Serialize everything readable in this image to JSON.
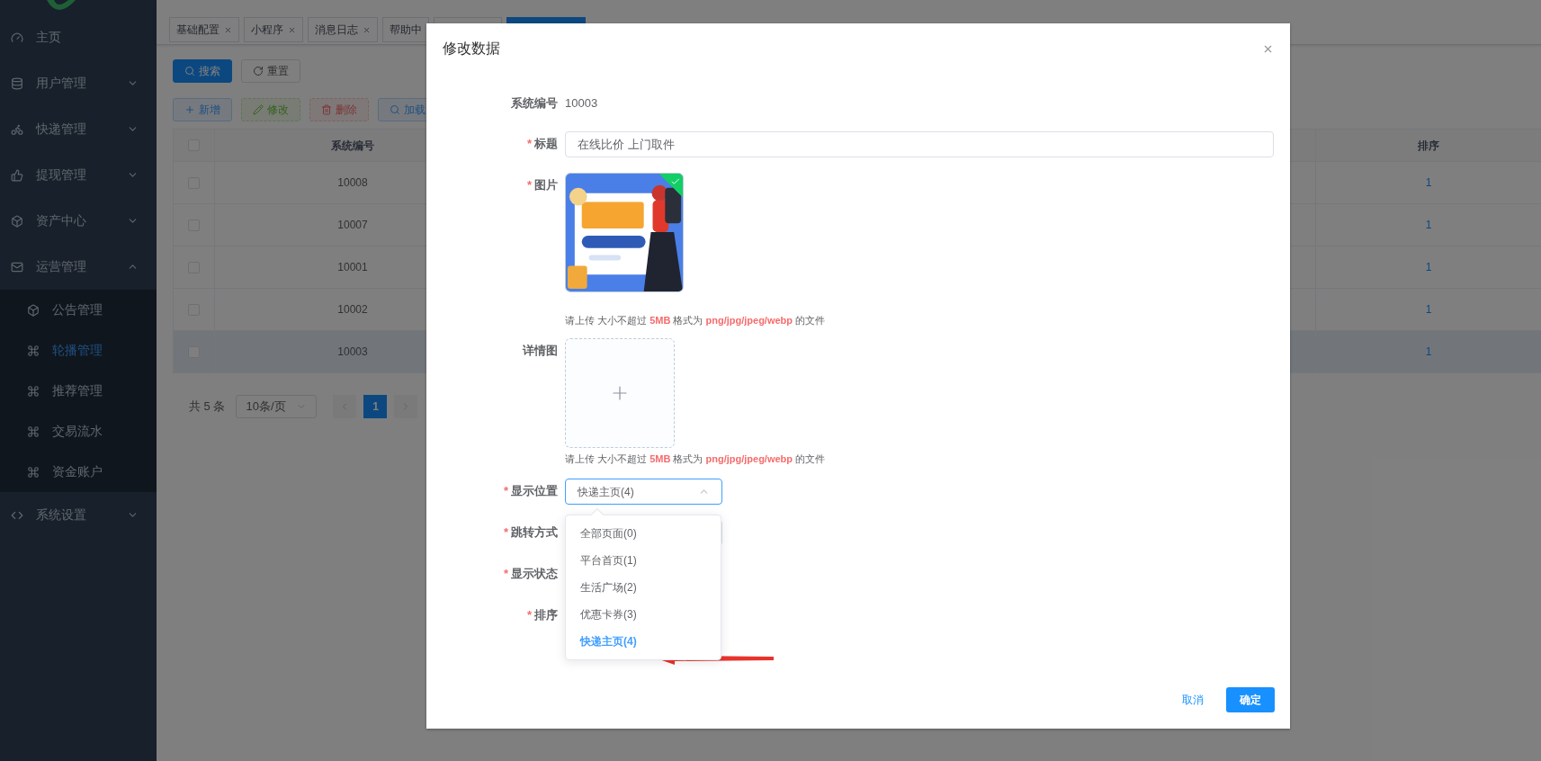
{
  "sidebar": {
    "items": [
      {
        "label": "主页",
        "selected": false
      },
      {
        "label": "用户管理",
        "selected": false,
        "expanded": false
      },
      {
        "label": "快递管理",
        "selected": false,
        "expanded": false
      },
      {
        "label": "提现管理",
        "selected": false,
        "expanded": false
      },
      {
        "label": "资产中心",
        "selected": false,
        "expanded": false
      },
      {
        "label": "运营管理",
        "selected": false,
        "expanded": true,
        "children": [
          {
            "label": "公告管理",
            "selected": false
          },
          {
            "label": "轮播管理",
            "selected": true
          },
          {
            "label": "推荐管理",
            "selected": false
          },
          {
            "label": "交易流水",
            "selected": false
          },
          {
            "label": "资金账户",
            "selected": false
          }
        ]
      },
      {
        "label": "系统设置",
        "selected": false,
        "expanded": false
      }
    ]
  },
  "tabs": [
    {
      "label": "基础配置",
      "selected": false,
      "closable": true
    },
    {
      "label": "小程序",
      "selected": false,
      "closable": true
    },
    {
      "label": "消息日志",
      "selected": false,
      "closable": true
    },
    {
      "label": "帮助中",
      "selected": false
    },
    {
      "selected": false
    },
    {
      "selected": true
    }
  ],
  "search_buttons": [
    {
      "kind": "primary",
      "label": "搜索"
    },
    {
      "kind": "default",
      "label": "重置"
    }
  ],
  "toolbar": [
    {
      "kind": "primary",
      "label": "新增",
      "disabled": false
    },
    {
      "kind": "success",
      "label": "修改",
      "disabled": true
    },
    {
      "kind": "danger",
      "label": "删除",
      "disabled": true
    },
    {
      "kind": "info",
      "label": "加载",
      "disabled": false
    }
  ],
  "table": {
    "columns": [
      "系统编号",
      "排序"
    ],
    "all_checked": false,
    "rows": [
      {
        "id": "10008",
        "sort": "1",
        "checked": false,
        "selected": false
      },
      {
        "id": "10007",
        "sort": "1",
        "checked": false,
        "selected": false
      },
      {
        "id": "10001",
        "sort": "1",
        "checked": false,
        "selected": false
      },
      {
        "id": "10002",
        "sort": "1",
        "checked": false,
        "selected": false
      },
      {
        "id": "10003",
        "sort": "1",
        "checked": false,
        "selected": true
      }
    ]
  },
  "pagination": {
    "total": "共 5 条",
    "page_size": "10条/页",
    "pages": [
      {
        "label": "1",
        "selected": true
      }
    ]
  },
  "dialog": {
    "title": "修改数据",
    "fields": [
      {
        "kind": "text",
        "label": "系统编号",
        "value": "10003"
      },
      {
        "kind": "input",
        "label": "标题",
        "required_mark": "*",
        "value": "在线比价 上门取件"
      },
      {
        "label": "图片",
        "required_mark": "*",
        "uploaded": true,
        "hint": "请上传 大小不超过 **5MB** 格式为 **png/jpg/jpeg/webp** 的文件"
      },
      {
        "kind": "upload",
        "label": "详情图",
        "hint": "请上传 大小不超过 **5MB** 格式为 **png/jpg/jpeg/webp** 的文件"
      },
      {
        "kind": "select",
        "label": "显示位置",
        "required_mark": "*",
        "value": "快递主页(4)",
        "expanded": true,
        "options": [
          {
            "label": "全部页面(0)",
            "selected": false
          },
          {
            "label": "平台首页(1)",
            "selected": false
          },
          {
            "label": "生活广场(2)",
            "selected": false
          },
          {
            "label": "优惠卡券(3)",
            "selected": false
          },
          {
            "label": "快递主页(4)",
            "selected": true
          }
        ]
      },
      {
        "kind": "select",
        "label": "跳转方式",
        "required_mark": "*",
        "expanded": false
      },
      {
        "kind": "blank",
        "label": "显示状态",
        "required_mark": "*"
      },
      {
        "kind": "blank",
        "label": "排序",
        "required_mark": "*"
      }
    ],
    "buttons": [
      {
        "kind": "text",
        "label": "取消"
      },
      {
        "kind": "primary",
        "label": "确定"
      }
    ]
  }
}
